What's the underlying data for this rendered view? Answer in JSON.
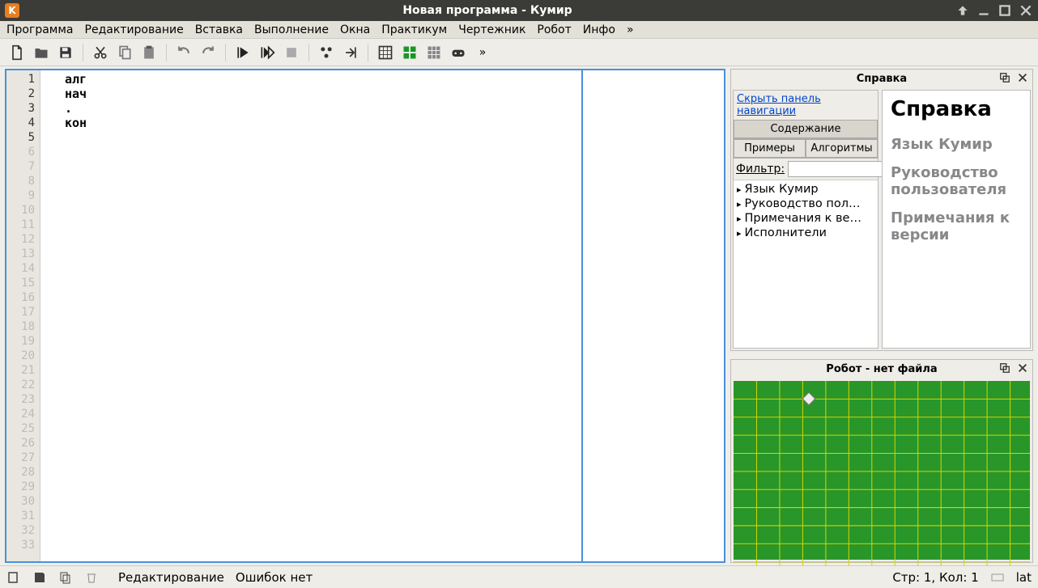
{
  "window": {
    "title": "Новая программа - Кумир"
  },
  "menu": {
    "items": [
      "Программа",
      "Редактирование",
      "Вставка",
      "Выполнение",
      "Окна",
      "Практикум",
      "Чертежник",
      "Робот",
      "Инфо",
      "»"
    ]
  },
  "editor": {
    "lines": [
      "алг",
      "нач",
      ".",
      "кон",
      ""
    ],
    "total_gutter_lines": 33
  },
  "help": {
    "panel_title": "Справка",
    "nav_hide_link": "Скрыть панель навигации",
    "tabs": {
      "contents": "Содержание",
      "examples": "Примеры",
      "algorithms": "Алгоритмы"
    },
    "filter_label": "Фильтр:",
    "filter_value": "",
    "tree": [
      "Язык Кумир",
      "Руководство пол…",
      "Примечания к ве…",
      "Исполнители"
    ],
    "content": {
      "h1": "Справка",
      "sections": [
        "Язык Кумир",
        "Руководство пользователя",
        "Примечания к версии"
      ]
    }
  },
  "robot": {
    "panel_title": "Робот - нет файла"
  },
  "status": {
    "mode": "Редактирование",
    "errors": "Ошибок нет",
    "position": "Стр: 1, Кол: 1",
    "lang": "lat"
  }
}
